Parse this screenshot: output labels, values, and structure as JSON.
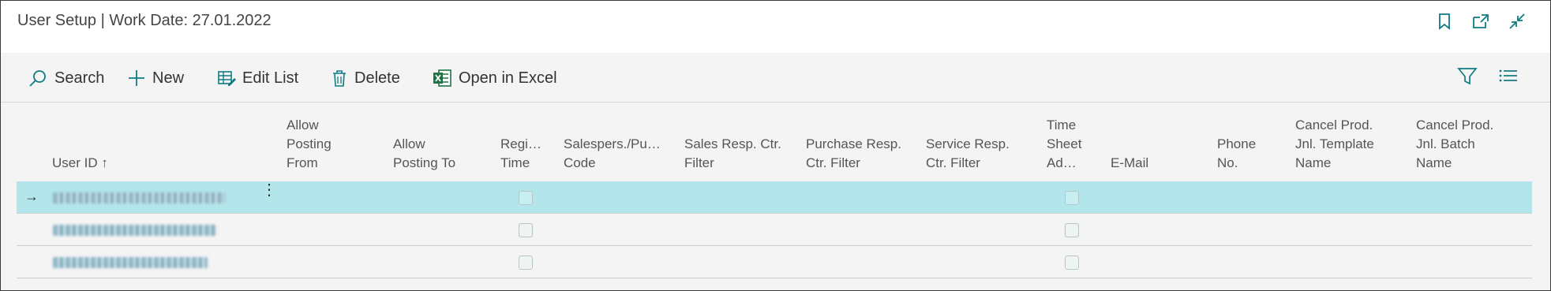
{
  "window": {
    "title": "User Setup | Work Date: 27.01.2022",
    "icons": [
      "bookmark-icon",
      "open-new-window-icon",
      "collapse-icon"
    ]
  },
  "actions": [
    {
      "label": "Search",
      "icon": "search-icon"
    },
    {
      "label": "New",
      "icon": "plus-icon"
    },
    {
      "label": "Edit List",
      "icon": "edit-list-icon"
    },
    {
      "label": "Delete",
      "icon": "trash-icon"
    },
    {
      "label": "Open in Excel",
      "icon": "excel-icon"
    }
  ],
  "right_icons": [
    "filter-icon",
    "list-view-icon"
  ],
  "columns": [
    {
      "label": "User ID ↑"
    },
    {
      "label": "Allow Posting From"
    },
    {
      "label": "Allow Posting To"
    },
    {
      "label": "Regi… Time"
    },
    {
      "label": "Salespers./Pu… Code"
    },
    {
      "label": "Sales Resp. Ctr. Filter"
    },
    {
      "label": "Purchase Resp. Ctr. Filter"
    },
    {
      "label": "Service Resp. Ctr. Filter"
    },
    {
      "label": "Time Sheet Ad…"
    },
    {
      "label": "E-Mail"
    },
    {
      "label": "Phone No."
    },
    {
      "label": "Cancel Prod. Jnl. Template Name"
    },
    {
      "label": "Cancel Prod. Jnl. Batch Name"
    }
  ],
  "rows": [
    {
      "user_id": "",
      "selected": true,
      "register_time": false,
      "time_sheet_admin": false
    },
    {
      "user_id": "",
      "selected": false,
      "register_time": false,
      "time_sheet_admin": false
    },
    {
      "user_id": "",
      "selected": false,
      "register_time": false,
      "time_sheet_admin": false
    }
  ],
  "colors": {
    "accent": "#0f7b83",
    "selected_row": "#b3e6ea",
    "excel_green": "#217346"
  }
}
